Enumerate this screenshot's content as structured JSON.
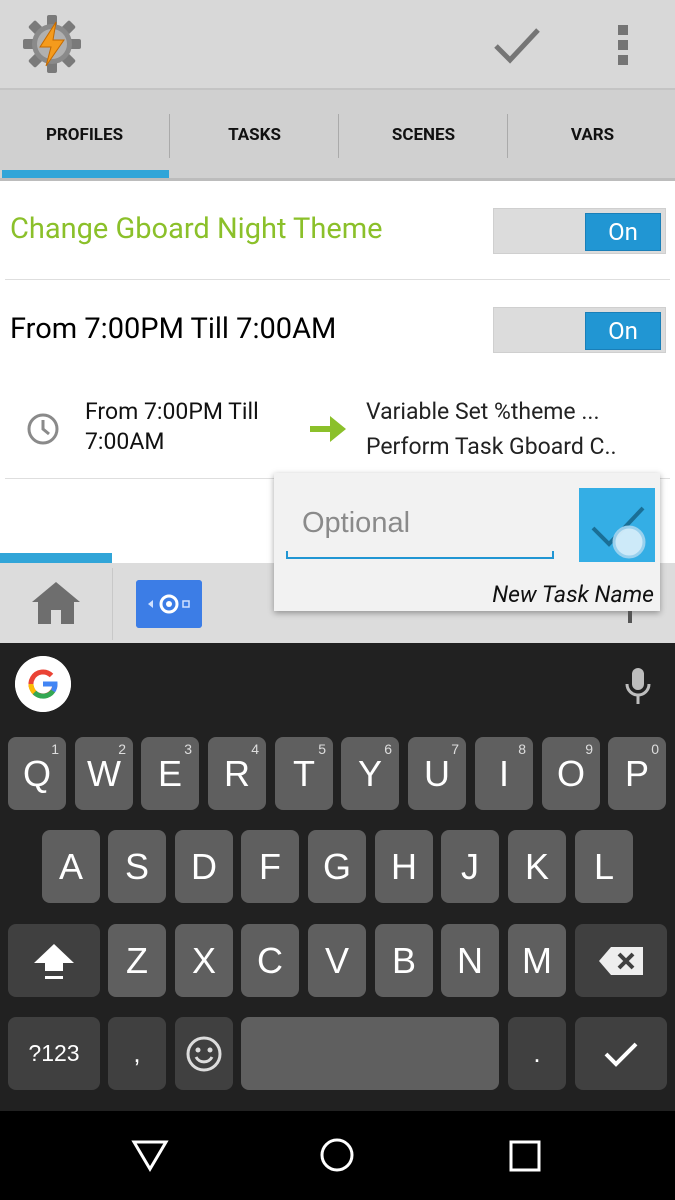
{
  "tabs": [
    "PROFILES",
    "TASKS",
    "SCENES",
    "VARS"
  ],
  "profile": {
    "name": "Change Gboard Night Theme",
    "toggle_label": "On"
  },
  "context": {
    "title": "From  7:00PM Till  7:00AM",
    "toggle_label": "On",
    "summary_line1": "From  7:00PM Till",
    "summary_line2": "7:00AM",
    "task_line1": "Variable Set %theme ...",
    "task_line2": "Perform Task Gboard C.."
  },
  "popup": {
    "placeholder": "Optional",
    "label": "New Task Name"
  },
  "keyboard": {
    "row1": [
      [
        "Q",
        "1"
      ],
      [
        "W",
        "2"
      ],
      [
        "E",
        "3"
      ],
      [
        "R",
        "4"
      ],
      [
        "T",
        "5"
      ],
      [
        "Y",
        "6"
      ],
      [
        "U",
        "7"
      ],
      [
        "I",
        "8"
      ],
      [
        "O",
        "9"
      ],
      [
        "P",
        "0"
      ]
    ],
    "row2": [
      "A",
      "S",
      "D",
      "F",
      "G",
      "H",
      "J",
      "K",
      "L"
    ],
    "row3": [
      "Z",
      "X",
      "C",
      "V",
      "B",
      "N",
      "M"
    ],
    "symbols_label": "?123",
    "comma_label": ",",
    "period_label": "."
  },
  "colors": {
    "accent": "#31a5d8",
    "profile_green": "#8bc02a",
    "toggle_blue": "#2196d3"
  }
}
